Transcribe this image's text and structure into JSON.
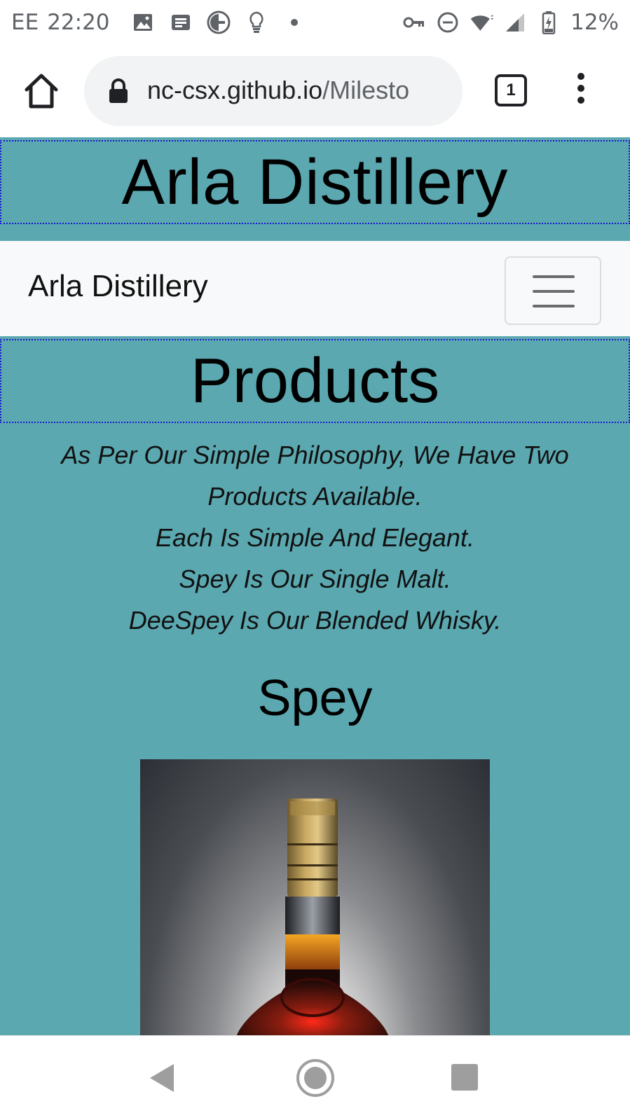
{
  "status_bar": {
    "carrier": "EE",
    "time": "22:20",
    "battery": "12%",
    "icons_left": [
      "image-icon",
      "news-icon",
      "g-app-icon",
      "lightbulb-icon",
      "dot-icon"
    ],
    "icons_right": [
      "key-icon",
      "dnd-icon",
      "wifi-icon",
      "signal-icon",
      "battery-icon"
    ]
  },
  "browser": {
    "url_host": "nc-csx.github.io",
    "url_path": "/Milesto",
    "tab_count": "1"
  },
  "page": {
    "header_title": "Arla Distillery",
    "navbar_brand": "Arla Distillery",
    "section_title": "Products",
    "intro_lines": [
      "As Per Our Simple Philosophy, We Have Two Products Available.",
      "Each Is Simple And Elegant.",
      "Spey Is Our Single Malt.",
      "DeeSpey Is Our Blended Whisky."
    ],
    "product_title": "Spey"
  },
  "colors": {
    "page_bg": "#5ba8b0",
    "navbar_bg": "#f8f9fa",
    "outline": "#1a1acc"
  }
}
